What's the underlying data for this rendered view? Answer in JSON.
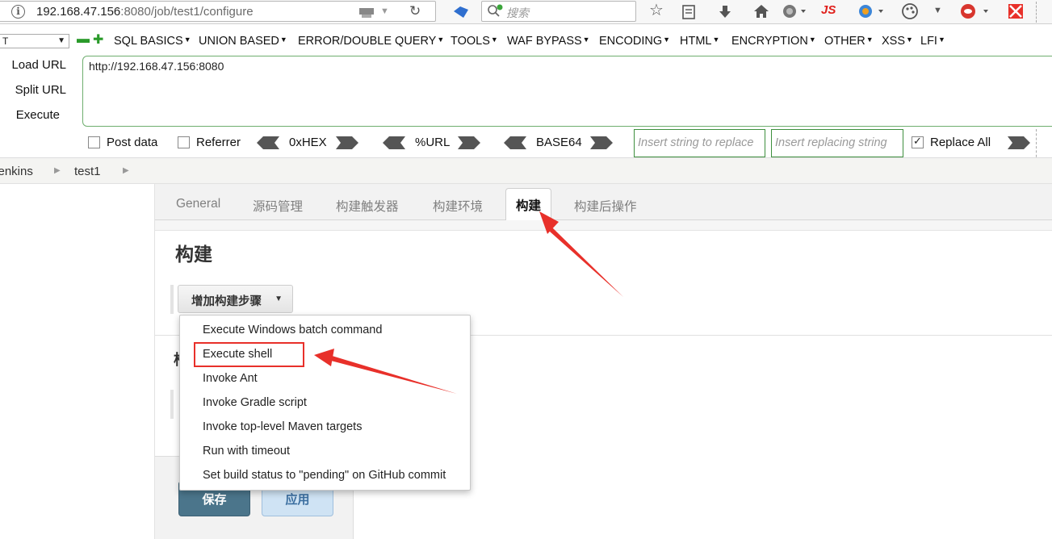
{
  "browser": {
    "url_host": "192.168.47.156",
    "url_rest": ":8080/job/test1/configure",
    "search_placeholder": "搜索"
  },
  "hackbar": {
    "menu_items": [
      "SQL BASICS",
      "UNION BASED",
      "ERROR/DOUBLE QUERY",
      "TOOLS",
      "WAF BYPASS",
      "ENCODING",
      "HTML",
      "ENCRYPTION",
      "OTHER",
      "XSS",
      "LFI"
    ],
    "load_url": "Load URL",
    "split_url": "Split URL",
    "execute": "Execute",
    "url_value": "http://192.168.47.156:8080",
    "post_data": "Post data",
    "referrer": "Referrer",
    "hex": "0xHEX",
    "urlenc": "%URL",
    "base64": "BASE64",
    "insert_ph": "Insert string to replace",
    "replacing_ph": "Insert replacing string",
    "replace_all": "Replace All"
  },
  "breadcrumb": [
    "Jenkins",
    "test1"
  ],
  "tabs": [
    "General",
    "源码管理",
    "构建触发器",
    "构建环境",
    "构建",
    "构建后操作"
  ],
  "section_title": "构建",
  "add_step_label": "增加构建步骤",
  "ghost_char": "构",
  "dropdown_items": [
    "Execute Windows batch command",
    "Execute shell",
    "Invoke Ant",
    "Invoke Gradle script",
    "Invoke top-level Maven targets",
    "Run with timeout",
    "Set build status to \"pending\" on GitHub commit"
  ],
  "buttons": {
    "save": "保存",
    "apply": "应用"
  },
  "colors": {
    "annotation_red": "#e8302a",
    "save_blue": "#4b758b",
    "hackbar_green": "#3e8f3e"
  }
}
